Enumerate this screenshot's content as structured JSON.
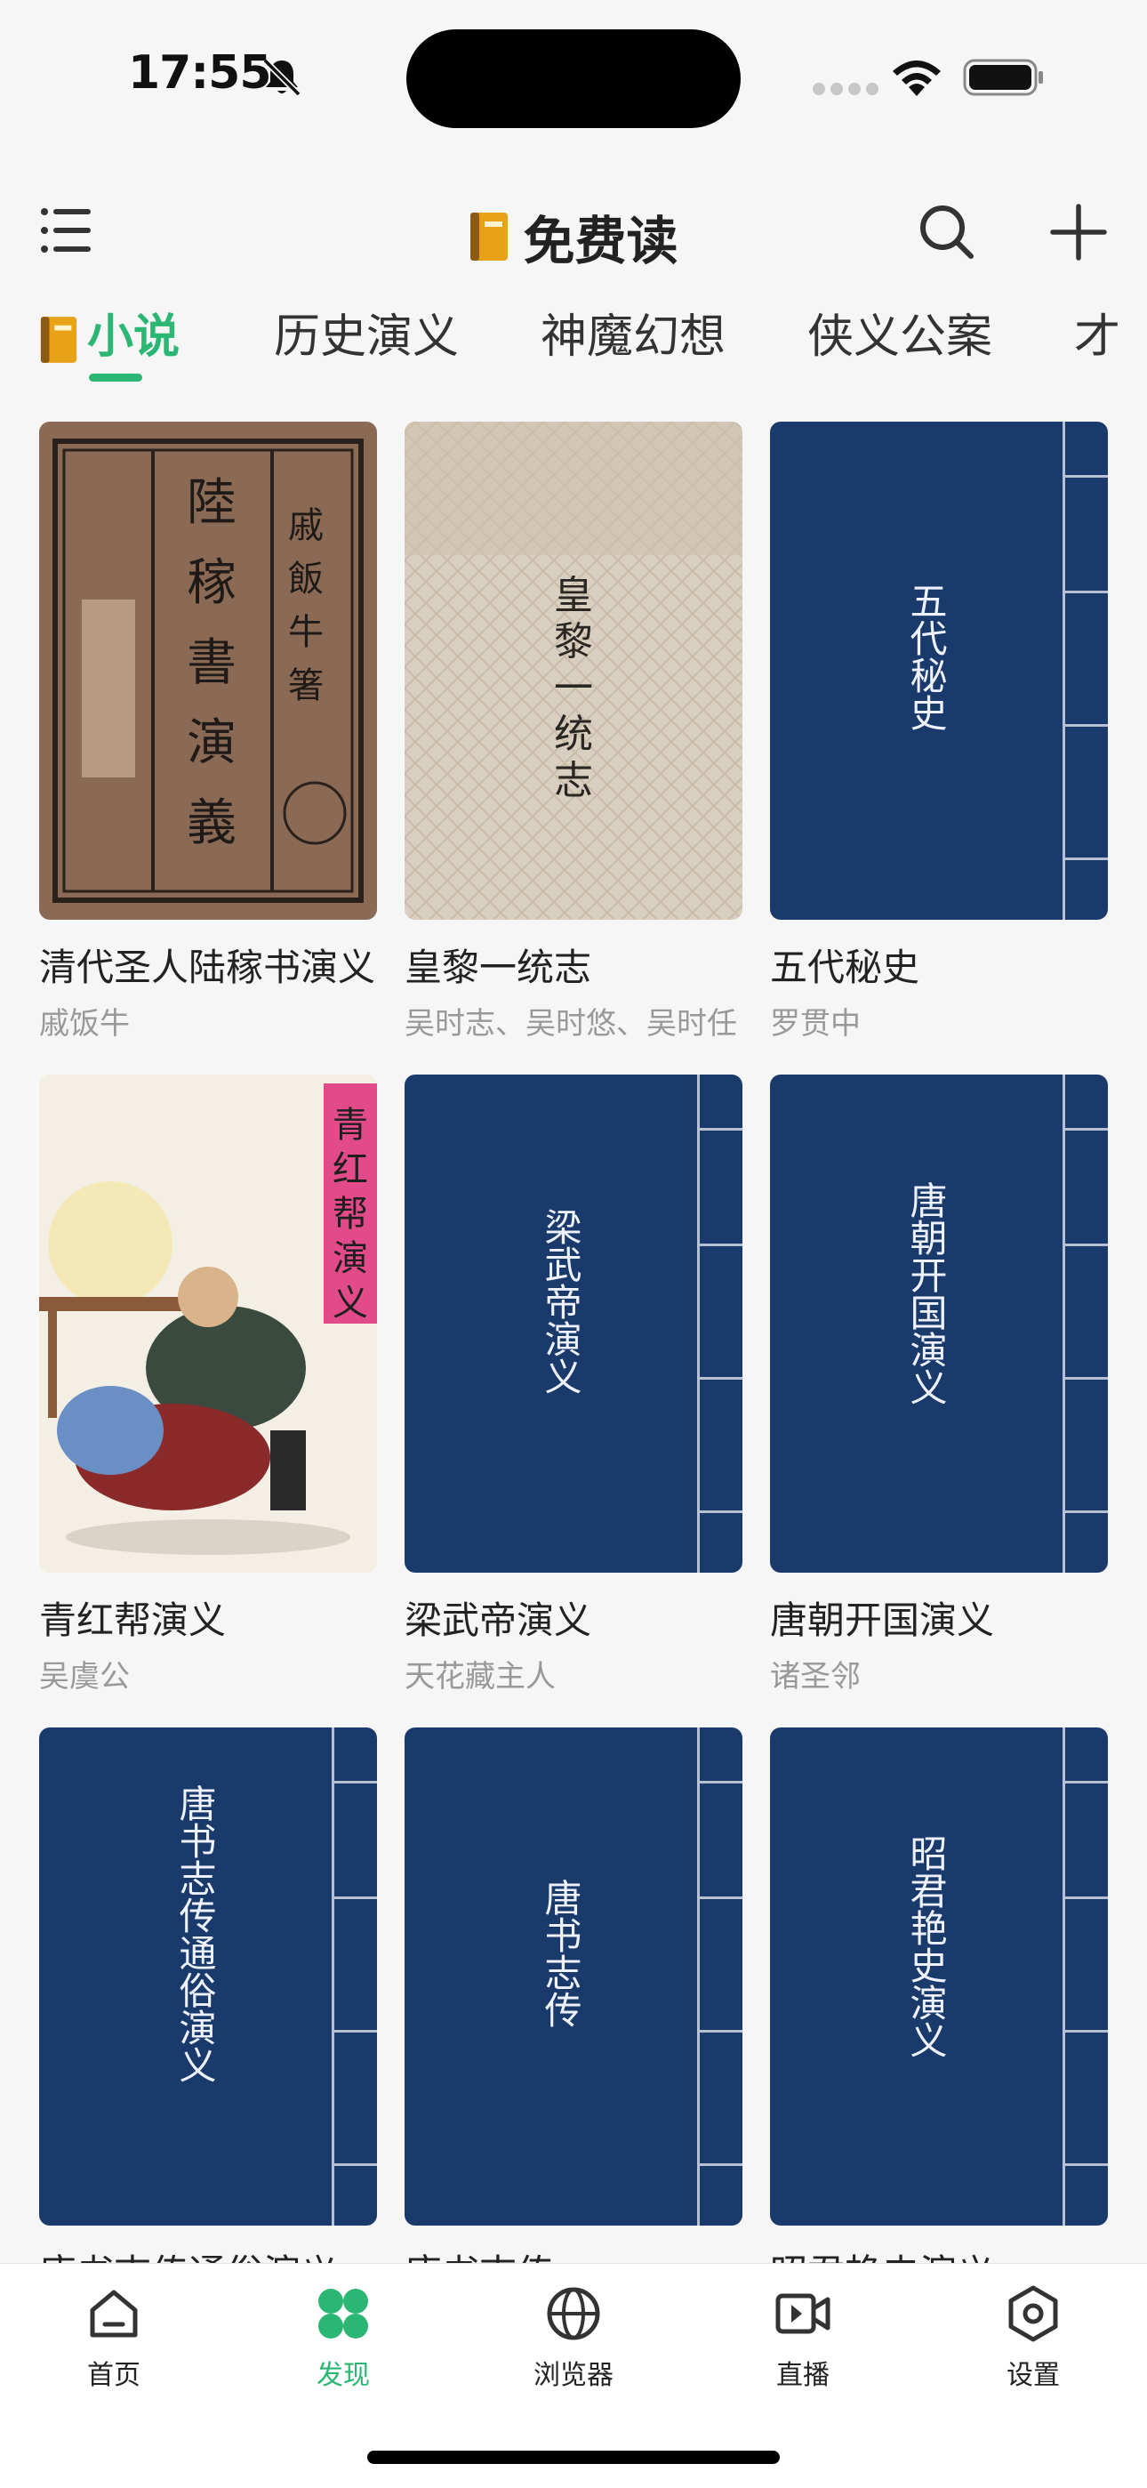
{
  "status_bar": {
    "time": "17:55"
  },
  "header": {
    "title": "免费读"
  },
  "tabs": [
    "小说",
    "历史演义",
    "神魔幻想",
    "侠义公案",
    "才"
  ],
  "books": [
    {
      "title": "清代圣人陆稼书演义",
      "author": "戚饭牛",
      "cover_text": "清代聖人陸稼書演義 戚飯牛箸"
    },
    {
      "title": "皇黎一统志",
      "author": "吴时志、吴时悠、吴时任",
      "cover_text": "皇黎一统志"
    },
    {
      "title": "五代秘史",
      "author": "罗贯中",
      "cover_text": "五代秘史"
    },
    {
      "title": "青红帮演义",
      "author": "吴虞公",
      "cover_text": "青红帮演义"
    },
    {
      "title": "梁武帝演义",
      "author": "天花藏主人",
      "cover_text": "梁武帝演义"
    },
    {
      "title": "唐朝开国演义",
      "author": "诸圣邻",
      "cover_text": "唐朝开国演义"
    },
    {
      "title": "唐书志传通俗演义",
      "author": "",
      "cover_text": "唐书志传通俗演义"
    },
    {
      "title": "唐书志传",
      "author": "",
      "cover_text": "唐书志传"
    },
    {
      "title": "昭君艳史演义",
      "author": "",
      "cover_text": "昭君艳史演义"
    }
  ],
  "bottom_nav": [
    "首页",
    "发现",
    "浏览器",
    "直播",
    "设置"
  ],
  "colors": {
    "accent": "#2bb673",
    "cover_blue": "#1a3a6b"
  }
}
